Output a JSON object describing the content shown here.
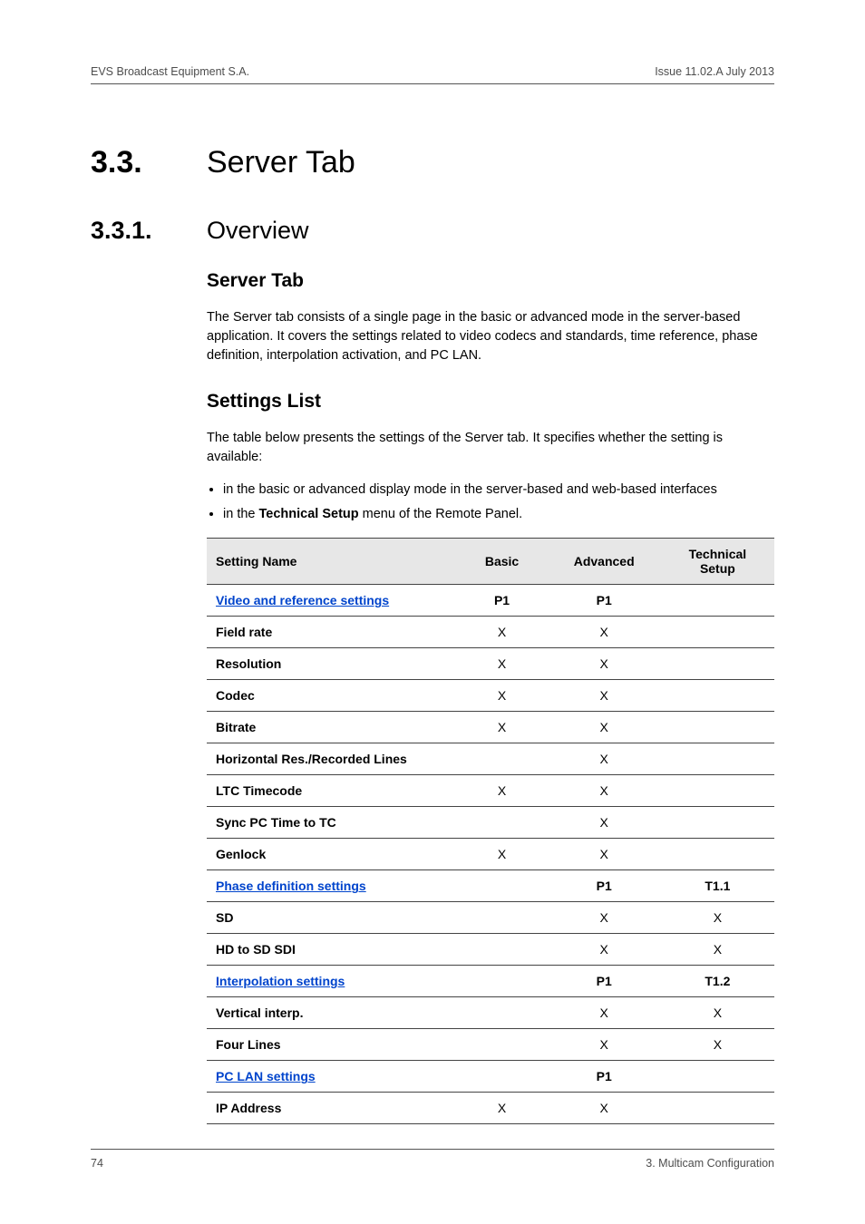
{
  "running_header": {
    "left": "EVS Broadcast Equipment S.A.",
    "right": "Issue 11.02.A  July 2013"
  },
  "h1": {
    "num": "3.3.",
    "title": "Server Tab"
  },
  "h2": {
    "num": "3.3.1.",
    "title": "Overview"
  },
  "sec1": {
    "heading": "Server Tab",
    "para": "The Server tab consists of a single page in the basic or advanced mode in the server-based application. It covers the settings related to video codecs and standards, time reference, phase definition, interpolation activation, and PC LAN."
  },
  "sec2": {
    "heading": "Settings List",
    "intro": "The table below presents the settings of the Server tab. It specifies whether the setting is available:",
    "bullet1_pre": "in the basic or advanced display mode in the server-based and web-based interfaces",
    "bullet2_pre": "in the ",
    "bullet2_bold": "Technical Setup",
    "bullet2_post": " menu of the Remote Panel."
  },
  "table": {
    "headers": {
      "name": "Setting Name",
      "basic": "Basic",
      "advanced": "Advanced",
      "tech": "Technical Setup"
    },
    "rows": [
      {
        "type": "section",
        "link": true,
        "name": "Video and reference settings",
        "basic": "P1",
        "advanced": "P1",
        "tech": ""
      },
      {
        "type": "data",
        "name": "Field rate",
        "basic": "X",
        "advanced": "X",
        "tech": ""
      },
      {
        "type": "data",
        "name": "Resolution",
        "basic": "X",
        "advanced": "X",
        "tech": ""
      },
      {
        "type": "data",
        "name": "Codec",
        "basic": "X",
        "advanced": "X",
        "tech": ""
      },
      {
        "type": "data",
        "name": "Bitrate",
        "basic": "X",
        "advanced": "X",
        "tech": ""
      },
      {
        "type": "data",
        "name": "Horizontal Res./Recorded Lines",
        "basic": "",
        "advanced": "X",
        "tech": ""
      },
      {
        "type": "data",
        "name": "LTC Timecode",
        "basic": "X",
        "advanced": "X",
        "tech": ""
      },
      {
        "type": "data",
        "name": "Sync PC Time to TC",
        "basic": "",
        "advanced": "X",
        "tech": ""
      },
      {
        "type": "data",
        "name": "Genlock",
        "basic": "X",
        "advanced": "X",
        "tech": ""
      },
      {
        "type": "section",
        "link": true,
        "name": "Phase definition settings",
        "basic": "",
        "advanced": "P1",
        "tech": "T1.1"
      },
      {
        "type": "data",
        "name": "SD",
        "basic": "",
        "advanced": "X",
        "tech": "X"
      },
      {
        "type": "data",
        "name": "HD to SD SDI",
        "basic": "",
        "advanced": "X",
        "tech": "X"
      },
      {
        "type": "section",
        "link": true,
        "name": "Interpolation settings",
        "basic": "",
        "advanced": "P1",
        "tech": "T1.2"
      },
      {
        "type": "data",
        "name": "Vertical interp.",
        "basic": "",
        "advanced": "X",
        "tech": "X"
      },
      {
        "type": "data",
        "name": "Four Lines",
        "basic": "",
        "advanced": "X",
        "tech": "X"
      },
      {
        "type": "section",
        "link": true,
        "name": "PC LAN settings",
        "basic": "",
        "advanced": "P1",
        "tech": ""
      },
      {
        "type": "data",
        "name": "IP Address",
        "basic": "X",
        "advanced": "X",
        "tech": ""
      }
    ]
  },
  "footer": {
    "page": "74",
    "chapter": "3. Multicam Configuration"
  }
}
